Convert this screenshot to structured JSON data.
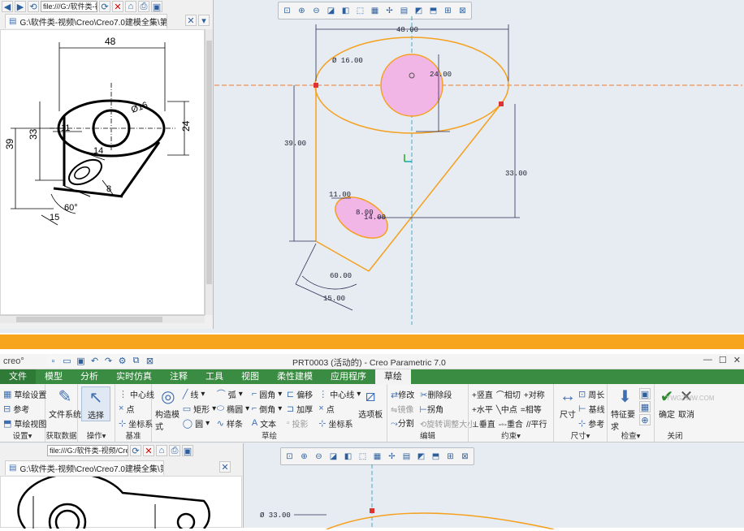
{
  "top": {
    "address": "file:///G:/软件类-视频/C",
    "tab_label": "G:\\软件类-视频\\Creo\\Creo7.0建模全集\\第1套",
    "drawing_dims": {
      "w48": "48",
      "r24": "24",
      "d16": "Ø16",
      "d39": "39",
      "d33": "33",
      "d11": "11",
      "d14": "14",
      "d8": "8",
      "a60": "60°",
      "d15": "15"
    },
    "sketch_dims": {
      "w48": "48.00",
      "d16": "Ø 16.00",
      "h24": "24.00",
      "h39": "39.00",
      "h33": "33.00",
      "d11": "11.00",
      "d8": "8.00",
      "d14": "14.00",
      "a60": "60.00",
      "d15": "15.00"
    }
  },
  "bottom": {
    "window_title": "PRT0003 (活动的) - Creo Parametric 7.0",
    "app_logo": "creo°",
    "menu": [
      "文件",
      "模型",
      "分析",
      "实时仿真",
      "注释",
      "工具",
      "视图",
      "柔性建模",
      "应用程序",
      "草绘"
    ],
    "groups": {
      "setup": {
        "items": [
          "草绘设置",
          "参考",
          "草绘视图"
        ],
        "label": "设置▾"
      },
      "get_data": {
        "big": "文件系统",
        "label": "获取数据"
      },
      "operate": {
        "big": "选择",
        "label": "操作▾"
      },
      "datum": {
        "items": [
          "中心线",
          "点",
          "坐标系"
        ],
        "label": "基准"
      },
      "sketch": {
        "construct": "构造模式",
        "col1": [
          "线",
          "矩形",
          "圆"
        ],
        "col2": [
          "弧",
          "椭圆",
          "样条"
        ],
        "col3": [
          "圆角",
          "倒角",
          "文本"
        ],
        "col4": [
          "偏移",
          "加厚",
          "投影"
        ],
        "col5": [
          "中心线",
          "点",
          "坐标系"
        ],
        "palette": "选项板",
        "label": "草绘"
      },
      "edit": {
        "items": [
          "修改",
          "删除段",
          "镜像",
          "拐角",
          "分割",
          "旋转调整大小"
        ],
        "label": "编辑"
      },
      "constrain": {
        "items": [
          "竖直",
          "相切",
          "对称",
          "水平",
          "中点",
          "相等",
          "垂直",
          "重合",
          "平行"
        ],
        "label": "约束▾"
      },
      "dimension": {
        "big": "尺寸",
        "items": [
          "周长",
          "基线",
          "参考"
        ],
        "label": "尺寸▾"
      },
      "inspect": {
        "big": "特征要求",
        "label": "检查▾"
      },
      "close": {
        "ok": "确定",
        "cancel": "取消",
        "label": "关闭"
      }
    },
    "address": "file:///G:/软件类-视频/Creo",
    "tab_label": "G:\\软件类-视频\\Creo\\Creo7.0建模全集\\第1套",
    "dim_d33": "Ø 33.00",
    "watermark": "YWGZWW.COM"
  },
  "colors": {
    "ribbon_green": "#3a8c42",
    "divider_orange": "#f6a51c",
    "sketch_orange": "#f5a01e",
    "fill_pink": "#f2b6e6"
  }
}
